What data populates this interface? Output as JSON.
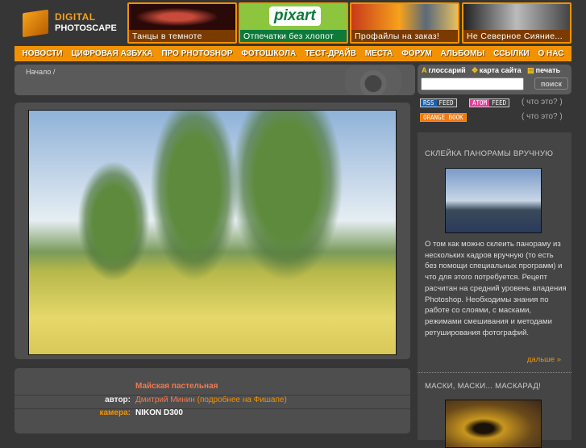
{
  "logo": {
    "line1": "DIGITAL",
    "line2": "PHOTOSCAPE"
  },
  "banners": [
    {
      "caption": "Танцы в темноте",
      "cap_color": "#7a3a00"
    },
    {
      "caption": "Отпечатки без хлопот",
      "cap_color": "#0e7a3a",
      "logo_text": "pixart"
    },
    {
      "caption": "Профайлы на заказ!",
      "cap_color": "#7a3a00"
    },
    {
      "caption": "Не Северное Сияние...",
      "cap_color": "#7a3a00"
    }
  ],
  "nav": [
    "НОВОСТИ",
    "ЦИФРОВАЯ АЗБУКА",
    "ПРО PHOTOSHOP",
    "ФОТОШКОЛА",
    "ТЕСТ-ДРАЙВ",
    "МЕСТА",
    "ФОРУМ",
    "АЛЬБОМЫ",
    "ССЫЛКИ",
    "О НАС"
  ],
  "breadcrumb": "Начало /",
  "tools": {
    "glossary": "глоссарий",
    "sitemap": "карта сайта",
    "print": "печать",
    "search_button": "поиск",
    "search_value": ""
  },
  "feeds": {
    "rss": "RSS",
    "rss_feed": "FEED",
    "atom": "ATOM",
    "atom_feed": "FEED",
    "orange": "ORANGE BOOK",
    "what": "что это?",
    "open": "(",
    "close": ")"
  },
  "sidebar": {
    "article1_title": "СКЛЕЙКА ПАНОРАМЫ ВРУЧНУЮ",
    "article1_text": "О том как можно склеить панораму из нескольких кадров вручную (то есть без помощи специальных программ) и что для этого потребуется. Рецепт расчитан на средний уровень владения Photoshop. Необходимы знания по работе со слоями, с масками, режимами смешивания и методами ретуширования фотографий.",
    "more": "дальше »",
    "article2_title": "МАСКИ, МАСКИ... МАСКАРАД!"
  },
  "photo_info": {
    "title": "Майская пастельная",
    "author_label": "автор:",
    "author": "Дмитрий Минин",
    "author_more": "(подробнее на Фишапе)",
    "camera_label": "камера:",
    "camera": "NIKON D300"
  }
}
